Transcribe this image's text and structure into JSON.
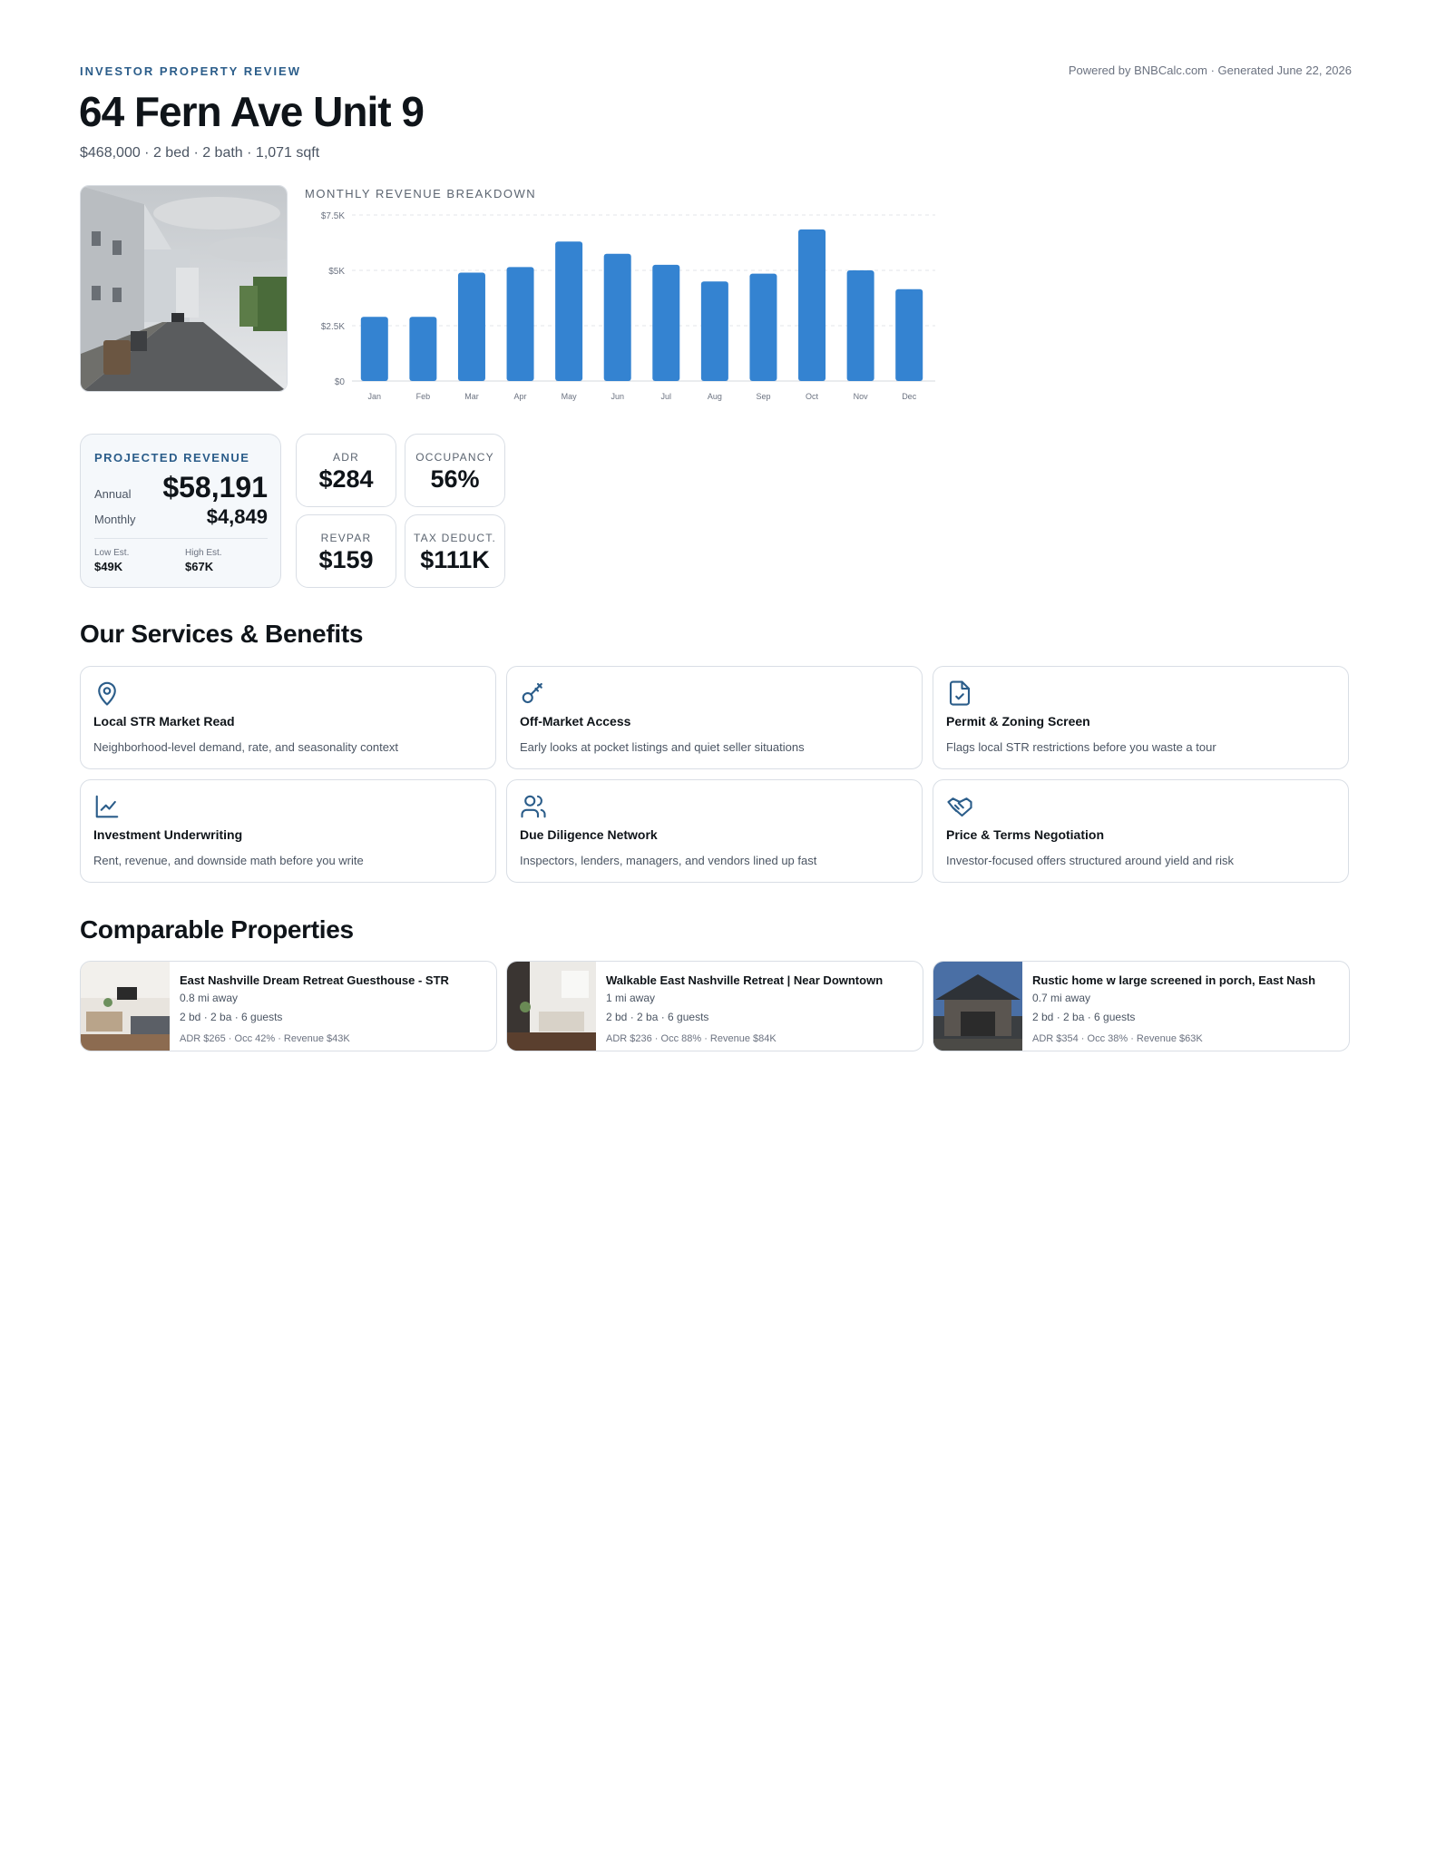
{
  "header": {
    "eyebrow": "INVESTOR PROPERTY REVIEW",
    "powered": "Powered by BNBCalc.com · Generated June 22, 2026",
    "title": "64 Fern Ave Unit 9",
    "subtitle": "$468,000 · 2 bed · 2 bath · 1,071 sqft"
  },
  "chart_data": {
    "type": "bar",
    "title": "MONTHLY REVENUE BREAKDOWN",
    "categories": [
      "Jan",
      "Feb",
      "Mar",
      "Apr",
      "May",
      "Jun",
      "Jul",
      "Aug",
      "Sep",
      "Oct",
      "Nov",
      "Dec"
    ],
    "values": [
      2900,
      2900,
      4900,
      5150,
      6300,
      5750,
      5250,
      4500,
      4850,
      6850,
      5000,
      4150
    ],
    "yticks": [
      "$0",
      "$2.5K",
      "$5K",
      "$7.5K"
    ],
    "ytick_values": [
      0,
      2500,
      5000,
      7500
    ],
    "ylim": [
      0,
      7500
    ],
    "color": "#3483d1",
    "grid": true
  },
  "revenue": {
    "label": "PROJECTED REVENUE",
    "annual_label": "Annual",
    "annual_value": "$58,191",
    "monthly_label": "Monthly",
    "monthly_value": "$4,849",
    "low_label": "Low Est.",
    "low_value": "$49K",
    "high_label": "High Est.",
    "high_value": "$67K"
  },
  "metrics": {
    "adr": {
      "label": "ADR",
      "value": "$284"
    },
    "occupancy": {
      "label": "OCCUPANCY",
      "value": "56%"
    },
    "revpar": {
      "label": "REVPAR",
      "value": "$159"
    },
    "tax": {
      "label": "TAX DEDUCT.",
      "value": "$111K"
    }
  },
  "services": {
    "heading": "Our Services & Benefits",
    "items": [
      {
        "icon": "map-pin-icon",
        "title": "Local STR Market Read",
        "desc": "Neighborhood-level demand, rate, and seasonality context"
      },
      {
        "icon": "key-icon",
        "title": "Off-Market Access",
        "desc": "Early looks at pocket listings and quiet seller situations"
      },
      {
        "icon": "document-check-icon",
        "title": "Permit & Zoning Screen",
        "desc": "Flags local STR restrictions before you waste a tour"
      },
      {
        "icon": "line-chart-icon",
        "title": "Investment Underwriting",
        "desc": "Rent, revenue, and downside math before you write"
      },
      {
        "icon": "users-icon",
        "title": "Due Diligence Network",
        "desc": "Inspectors, lenders, managers, and vendors lined up fast"
      },
      {
        "icon": "handshake-icon",
        "title": "Price & Terms Negotiation",
        "desc": "Investor-focused offers structured around yield and risk"
      }
    ]
  },
  "comparables": {
    "heading": "Comparable Properties",
    "items": [
      {
        "title": "East Nashville Dream Retreat Guesthouse - STR",
        "distance": "0.8 mi away",
        "specs": "2 bd · 2 ba · 6 guests",
        "stats": "ADR $265 · Occ 42% · Revenue $43K"
      },
      {
        "title": "Walkable East Nashville Retreat | Near Downtown",
        "distance": "1 mi away",
        "specs": "2 bd · 2 ba · 6 guests",
        "stats": "ADR $236 · Occ 88% · Revenue $84K"
      },
      {
        "title": "Rustic home w large screened in porch, East Nash",
        "distance": "0.7 mi away",
        "specs": "2 bd · 2 ba · 6 guests",
        "stats": "ADR $354 · Occ 38% · Revenue $63K"
      }
    ]
  },
  "colors": {
    "accent": "#2b5d8a",
    "bar": "#3483d1",
    "icon": "#2b5d8a"
  }
}
